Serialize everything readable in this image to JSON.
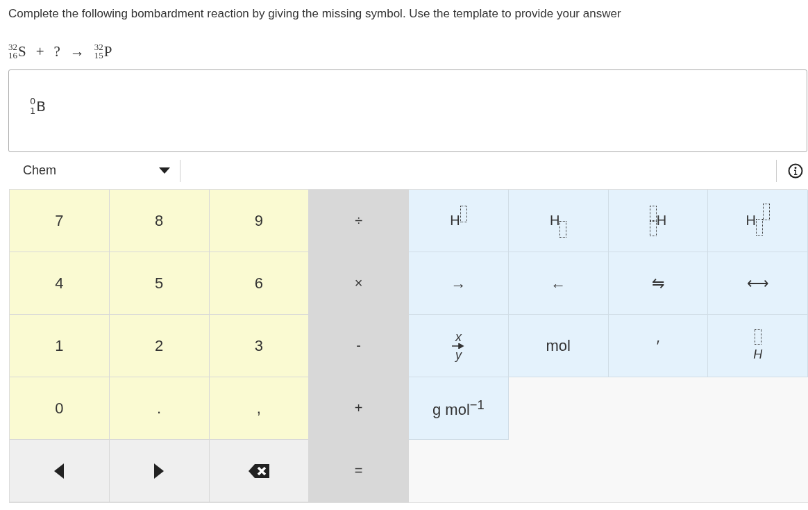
{
  "question": "Complete the following bombardment reaction by giving the missing symbol.  Use the template to provide your answer",
  "equation": [
    {
      "kind": "nuclide",
      "mass": "32",
      "atomic": "16",
      "symbol": "S"
    },
    {
      "kind": "text",
      "text": "+"
    },
    {
      "kind": "text",
      "text": "?"
    },
    {
      "kind": "text",
      "text": "→"
    },
    {
      "kind": "nuclide",
      "mass": "32",
      "atomic": "15",
      "symbol": "P"
    }
  ],
  "answer": {
    "mass": "0",
    "atomic": "1",
    "symbol": "B"
  },
  "toolbar": {
    "dropdown": "Chem"
  },
  "keypad": [
    [
      {
        "kind": "digit",
        "label": "7"
      },
      {
        "kind": "digit",
        "label": "8"
      },
      {
        "kind": "digit",
        "label": "9"
      },
      {
        "kind": "op",
        "label": "÷"
      },
      {
        "kind": "sup",
        "label": "H"
      },
      {
        "kind": "sub",
        "label": "H"
      },
      {
        "kind": "pre",
        "label": "H"
      },
      {
        "kind": "supsub",
        "label": "H"
      }
    ],
    [
      {
        "kind": "digit",
        "label": "4"
      },
      {
        "kind": "digit",
        "label": "5"
      },
      {
        "kind": "digit",
        "label": "6"
      },
      {
        "kind": "op",
        "label": "×"
      },
      {
        "kind": "chem",
        "label": "→"
      },
      {
        "kind": "chem",
        "label": "←"
      },
      {
        "kind": "chem",
        "label": "⇋"
      },
      {
        "kind": "chem",
        "label": "⟷"
      }
    ],
    [
      {
        "kind": "digit",
        "label": "1"
      },
      {
        "kind": "digit",
        "label": "2"
      },
      {
        "kind": "digit",
        "label": "3"
      },
      {
        "kind": "op",
        "label": "-"
      },
      {
        "kind": "condition",
        "top": "x",
        "bottom": "y"
      },
      {
        "kind": "chem",
        "label": "mol"
      },
      {
        "kind": "chem",
        "label": "′"
      },
      {
        "kind": "over",
        "label": "H"
      }
    ],
    [
      {
        "kind": "digit",
        "label": "0"
      },
      {
        "kind": "digit",
        "label": "."
      },
      {
        "kind": "digit",
        "label": ","
      },
      {
        "kind": "op",
        "label": "+"
      },
      {
        "kind": "chem",
        "label": "g mol$^{−1}$"
      }
    ],
    [
      {
        "kind": "left"
      },
      {
        "kind": "right"
      },
      {
        "kind": "backspace"
      },
      {
        "kind": "op",
        "label": "="
      }
    ]
  ]
}
